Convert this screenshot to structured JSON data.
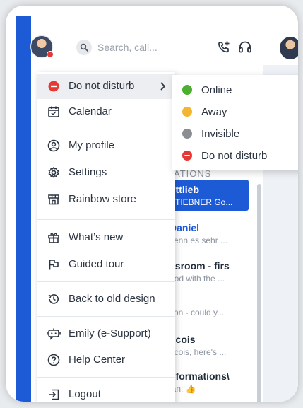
{
  "header": {
    "search_placeholder": "Search, call..."
  },
  "menu": {
    "items": [
      {
        "label": "Do not disturb",
        "icon": "do-not-disturb-icon"
      },
      {
        "label": "Calendar",
        "icon": "calendar-icon"
      },
      {
        "label": "My profile",
        "icon": "profile-icon"
      },
      {
        "label": "Settings",
        "icon": "gear-icon"
      },
      {
        "label": "Rainbow store",
        "icon": "store-icon"
      },
      {
        "label": "What’s new",
        "icon": "gift-icon"
      },
      {
        "label": "Guided tour",
        "icon": "flag-icon"
      },
      {
        "label": "Back to old design",
        "icon": "history-icon"
      },
      {
        "label": "Emily (e-Support)",
        "icon": "chatbot-icon"
      },
      {
        "label": "Help Center",
        "icon": "help-icon"
      },
      {
        "label": "Logout",
        "icon": "logout-icon"
      }
    ]
  },
  "status_menu": {
    "items": [
      {
        "label": "Online",
        "color": "#4caf32"
      },
      {
        "label": "Away",
        "color": "#f2b632"
      },
      {
        "label": "Invisible",
        "color": "#8a8d92"
      },
      {
        "label": "Do not disturb",
        "color": "#e53935"
      }
    ]
  },
  "conversations": {
    "heading": "ATIONS",
    "items": [
      {
        "title": "ottlieb",
        "subtitle": "STIEBNER Go..."
      },
      {
        "title": "Daniel",
        "subtitle": "venn es sehr ..."
      },
      {
        "title": "ssroom - firs",
        "subtitle": "ood with the ..."
      },
      {
        "title": "",
        "subtitle": "tion - could y..."
      },
      {
        "title": "ncois",
        "subtitle": "ncois, here's ..."
      },
      {
        "title": "nformations\\",
        "subtitle": "jan: 👍"
      }
    ]
  },
  "colors": {
    "brand_blue": "#1d5bd6",
    "dnd_red": "#e53935"
  }
}
